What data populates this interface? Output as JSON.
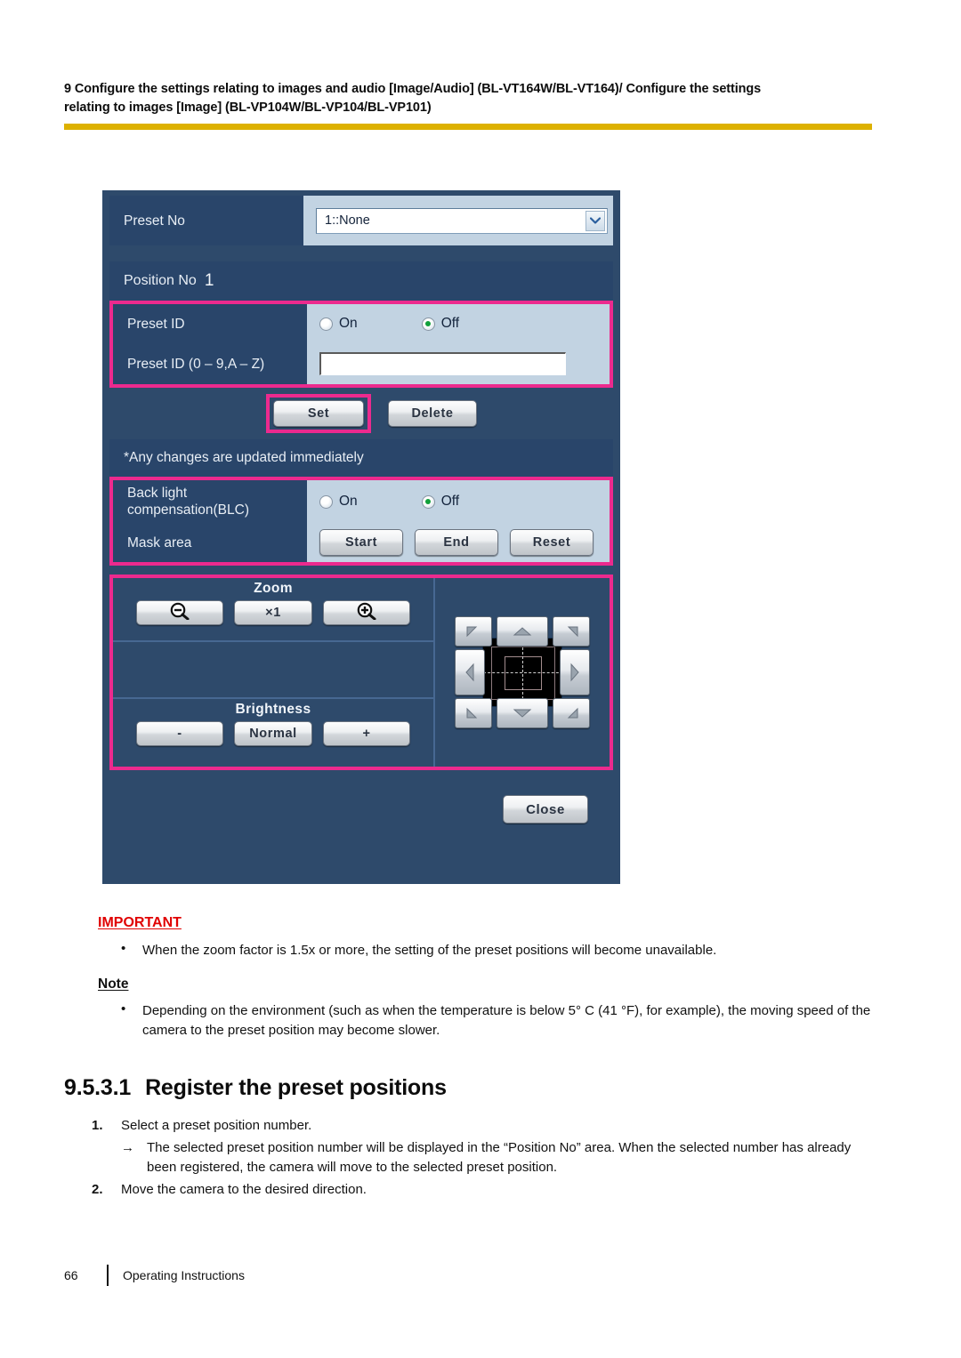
{
  "header": {
    "line1": "9 Configure the settings relating to images and audio [Image/Audio] (BL-VT164W/BL-VT164)/ Configure the settings",
    "line2": "relating to images [Image] (BL-VP104W/BL-VP104/BL-VP101)",
    "rule_color": "#ddb100"
  },
  "dialog": {
    "preset_no": {
      "label": "Preset No",
      "selected": "1::None"
    },
    "position_no": {
      "label": "Position No",
      "value": "1"
    },
    "preset_id": {
      "label": "Preset ID",
      "on_label": "On",
      "off_label": "Off",
      "selected": "Off"
    },
    "preset_id_field": {
      "label": "Preset ID (0 – 9,A – Z)",
      "value": "",
      "placeholder": ""
    },
    "actions": {
      "set_label": "Set",
      "delete_label": "Delete"
    },
    "notice": "*Any changes are updated immediately",
    "blc": {
      "label_line1": "Back light",
      "label_line2": "compensation(BLC)",
      "on_label": "On",
      "off_label": "Off",
      "selected": "Off"
    },
    "mask_area": {
      "label": "Mask area",
      "start_label": "Start",
      "end_label": "End",
      "reset_label": "Reset"
    },
    "zoom": {
      "title": "Zoom",
      "out_icon": "zoom-out-magnifier-icon",
      "reset_label": "×1",
      "in_icon": "zoom-in-magnifier-icon"
    },
    "brightness": {
      "title": "Brightness",
      "minus_label": "-",
      "normal_label": "Normal",
      "plus_label": "+"
    },
    "pan_tilt": {
      "up_left": "pan-up-left",
      "up": "pan-up",
      "up_right": "pan-up-right",
      "left": "pan-left",
      "right": "pan-right",
      "down_left": "pan-down-left",
      "down": "pan-down",
      "down_right": "pan-down-right"
    },
    "close_label": "Close",
    "colors": {
      "panel_bg": "#2e4a6b",
      "label_bg": "#29456a",
      "value_bg": "#c2d3e2",
      "highlight": "#ec2a8e",
      "radio_selected": "#11a03b"
    }
  },
  "important": {
    "title": "IMPORTANT",
    "title_color": "#e00000",
    "bullet_marker": "•",
    "bullets": [
      "When the zoom factor is 1.5x or more, the setting of the preset positions will become unavailable."
    ]
  },
  "note": {
    "title": "Note",
    "bullet_marker": "•",
    "bullets": [
      "Depending on the environment (such as when the temperature is below 5° C (41 °F), for example), the moving speed of the camera to the preset position may become slower."
    ]
  },
  "section": {
    "number": "9.5.3.1",
    "title": "Register the preset positions",
    "steps": [
      {
        "num": "1.",
        "text": "Select a preset position number.",
        "substep_arrow": "→",
        "substep_text": "The selected preset position number will be displayed in the “Position No” area. When the selected number has already been registered, the camera will move to the selected preset position."
      },
      {
        "num": "2.",
        "text": "Move the camera to the desired direction.",
        "substep_arrow": "",
        "substep_text": ""
      }
    ]
  },
  "footer": {
    "page_number": "66",
    "doc_title": "Operating Instructions"
  }
}
